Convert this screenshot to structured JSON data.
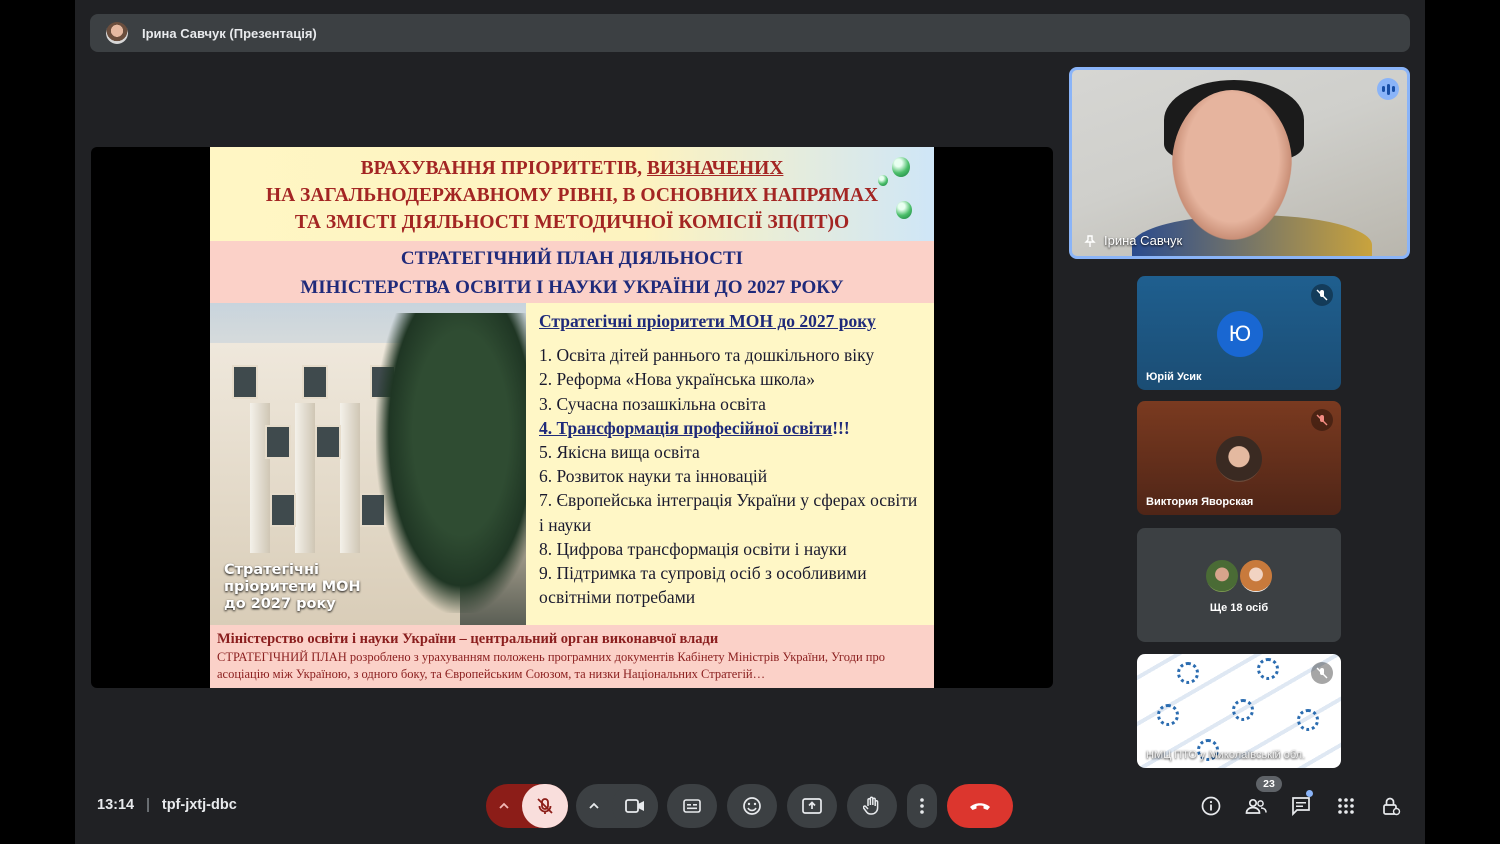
{
  "topbar": {
    "presenter_label": "Ірина Савчук (Презентація)"
  },
  "slide": {
    "header_lines": [
      "ВРАХУВАННЯ ПРІОРИТЕТІВ, ",
      "ВИЗНАЧЕНИХ",
      "НА ЗАГАЛЬНОДЕРЖАВНОМУ РІВНІ, В ОСНОВНИХ НАПРЯМАХ",
      "ТА ЗМІСТІ ДІЯЛЬНОСТІ МЕТОДИЧНОЇ КОМІСІЇ ЗП(ПТ)О"
    ],
    "subtitle_lines": [
      "СТРАТЕГІЧНИЙ ПЛАН ДІЯЛЬНОСТІ",
      "МІНІСТЕРСТВА ОСВІТИ І НАУКИ УКРАЇНИ ДО 2027 РОКУ"
    ],
    "photo_caption": [
      "Стратегічні",
      "пріоритети МОН",
      "до 2027 року"
    ],
    "list_title": "Стратегічні пріоритети МОН до 2027 року",
    "items": [
      "1. Освіта дітей раннього та дошкільного віку",
      "2. Реформа «Нова українська школа»",
      "3. Сучасна позашкільна освіта",
      "4. Трансформація професійної освіти",
      "5. Якісна вища освіта",
      "6. Розвиток науки та інновацій",
      "7. Європейська інтеграція України у сферах освіти і науки",
      "8. Цифрова трансформація освіти і науки",
      "9. Підтримка та супровід осіб з особливими освітніми потребами"
    ],
    "item4_suffix": "!!!",
    "footer_title": "Міністерство освіти і науки України – центральний орган виконавчої влади",
    "footer_text": "СТРАТЕГІЧНИЙ ПЛАН розроблено з урахуванням положень програмних документів Кабінету Міністрів України, Угоди про асоціацію між Україною, з одного боку, та Європейським Союзом, та низки Національних Стратегій…"
  },
  "participants": {
    "main": {
      "name": "Ірина Савчук"
    },
    "yurii": {
      "initial": "Ю",
      "name": "Юрій Усик"
    },
    "viktoria": {
      "name": "Виктория Яворская"
    },
    "more": {
      "label": "Ще 18 осіб"
    },
    "org": {
      "name": "НМЦ ПТО у Миколаївській обл."
    }
  },
  "meeting": {
    "time": "13:14",
    "separator": "|",
    "code": "tpf-jxtj-dbc"
  },
  "people_count": "23",
  "colors": {
    "accent": "#8ab4f8",
    "leave": "#dc362e",
    "mic_off_bg": "#f9dedc",
    "mic_group_bg": "#8c1d18",
    "tile_bg": "#3c4043"
  },
  "icons": {
    "mic": "mic-off-icon",
    "camera": "video-camera-icon",
    "captions": "captions-icon",
    "emoji": "emoji-icon",
    "present": "present-screen-icon",
    "hand": "raise-hand-icon",
    "more": "more-vertical-icon",
    "leave": "hang-up-icon",
    "info": "info-icon",
    "people": "people-icon",
    "chat": "chat-icon",
    "activities": "activities-icon",
    "host": "host-controls-icon"
  }
}
